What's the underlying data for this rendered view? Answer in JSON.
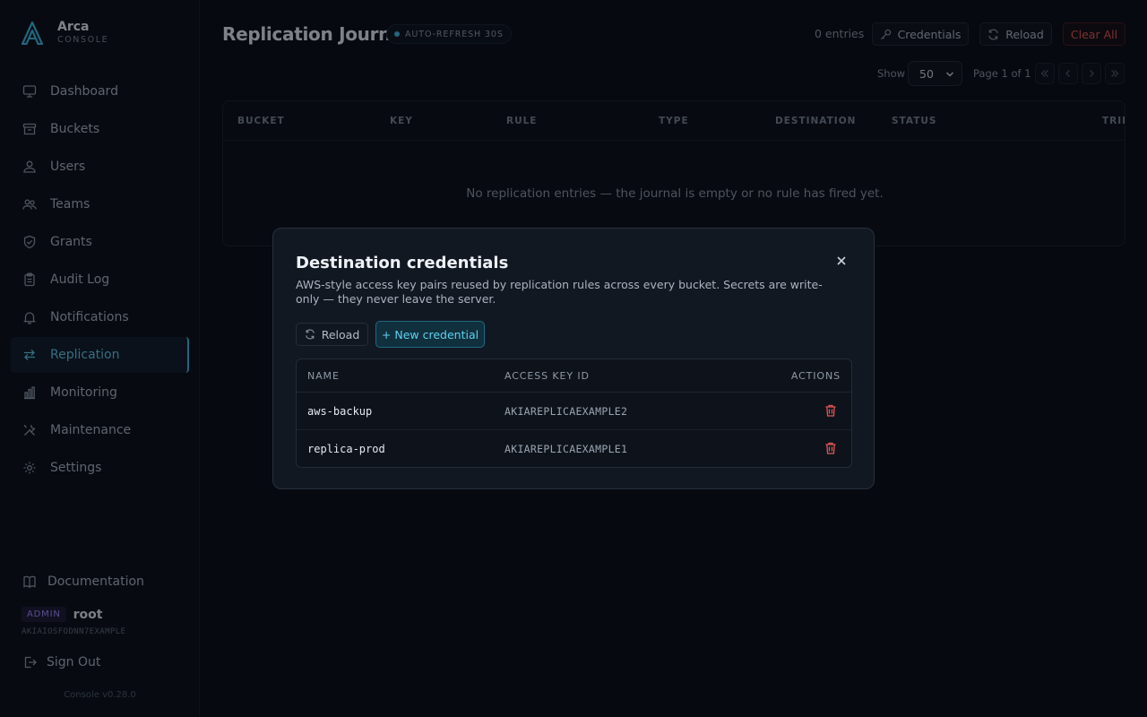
{
  "brand": {
    "name": "Arca",
    "subtitle": "CONSOLE"
  },
  "sidebar": {
    "items": [
      {
        "label": "Dashboard",
        "icon": "monitor-icon"
      },
      {
        "label": "Buckets",
        "icon": "bucket-icon"
      },
      {
        "label": "Users",
        "icon": "users-icon"
      },
      {
        "label": "Teams",
        "icon": "teams-icon"
      },
      {
        "label": "Grants",
        "icon": "shield-icon"
      },
      {
        "label": "Audit Log",
        "icon": "clipboard-icon"
      },
      {
        "label": "Notifications",
        "icon": "bell-icon"
      },
      {
        "label": "Replication",
        "icon": "arrows-swap-icon",
        "active": true
      },
      {
        "label": "Monitoring",
        "icon": "bar-chart-icon"
      },
      {
        "label": "Maintenance",
        "icon": "tools-icon"
      },
      {
        "label": "Settings",
        "icon": "gear-icon"
      }
    ],
    "documentation": "Documentation",
    "user": {
      "role_badge": "ADMIN",
      "name": "root",
      "access_key": "AKIAIOSFODNN7EXAMPLE"
    },
    "sign_out": "Sign Out",
    "version": "Console v0.28.0"
  },
  "header": {
    "title": "Replication Journal",
    "auto_refresh": "AUTO-REFRESH 30S",
    "entries_count": "0 entries",
    "credentials_button": "Credentials",
    "reload_button": "Reload",
    "clear_button": "Clear All"
  },
  "pagination": {
    "show_label": "Show",
    "page_size": "50",
    "page_info": "Page 1 of 1"
  },
  "journal_table": {
    "columns": [
      "BUCKET",
      "KEY",
      "RULE",
      "TYPE",
      "DESTINATION",
      "STATUS",
      "TRIES"
    ],
    "empty_message": "No replication entries — the journal is empty or no rule has fired yet."
  },
  "modal": {
    "title": "Destination credentials",
    "description": "AWS-style access key pairs reused by replication rules across every bucket. Secrets are write-only — they never leave the server.",
    "reload_button": "Reload",
    "new_button": "+ New credential",
    "columns": {
      "name": "NAME",
      "access_key_id": "ACCESS KEY ID",
      "actions": "ACTIONS"
    },
    "rows": [
      {
        "name": "aws-backup",
        "access_key_id": "AKIAREPLICAEXAMPLE2"
      },
      {
        "name": "replica-prod",
        "access_key_id": "AKIAREPLICAEXAMPLE1"
      }
    ]
  },
  "colors": {
    "accent": "#3fb6db",
    "danger": "#e25555",
    "background": "#0a0e15",
    "admin_badge": "#9b8cff"
  }
}
